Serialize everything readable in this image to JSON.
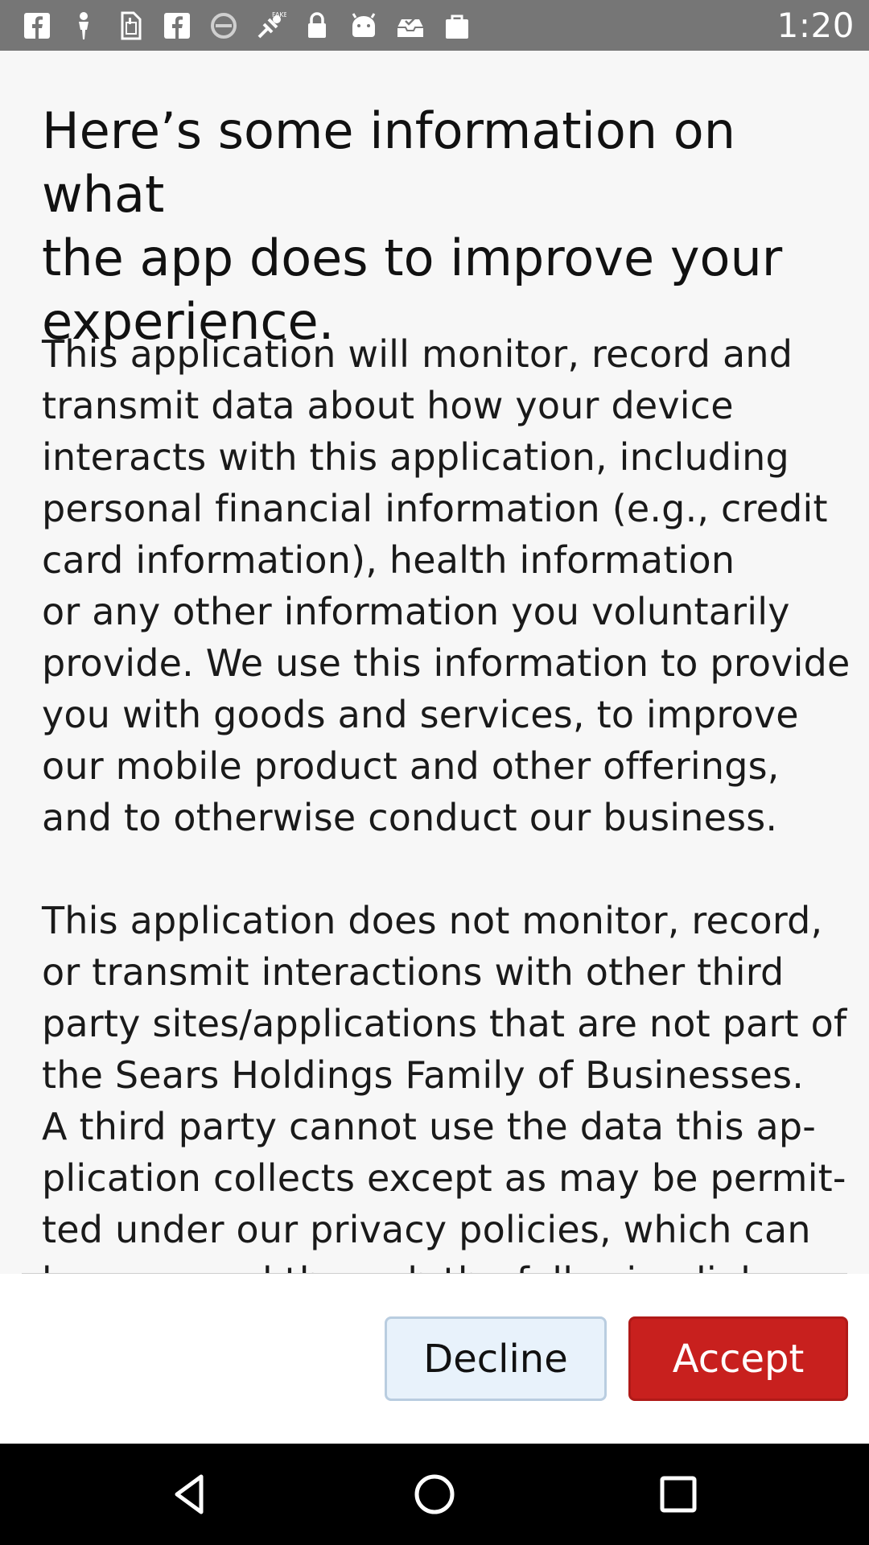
{
  "status_bar": {
    "time": "1:20",
    "icons": [
      "facebook-icon",
      "person-icon",
      "sim-icon",
      "facebook-icon",
      "blocked-icon",
      "fake-gps-icon",
      "lock-icon",
      "android-icon",
      "inbox-icon",
      "bag-icon"
    ],
    "background": "#767676"
  },
  "dialog": {
    "title": "Here’s some information on what\nthe app does to improve your\nexperience.",
    "body": "This application will monitor, record and\ntransmit data about how your device\ninteracts with this application, including\npersonal financial information (e.g., credit\ncard information), health information\nor any other information you voluntarily\nprovide. We use this information to provide\nyou with goods and services, to improve\nour mobile product and other offerings,\nand to otherwise conduct our business.\n\nThis application does not monitor, record,\nor transmit interactions with other third\nparty sites/applications that are not part of\nthe Sears Holdings Family of Businesses.\nA third party cannot use the data this ap-\nplication collects except as may be permit-\nted under our privacy policies, which can\nbe accessed through the following links:"
  },
  "buttons": {
    "decline_label": "Decline",
    "accept_label": "Accept",
    "accept_color": "#c8201e",
    "decline_color": "#e8f2fb"
  },
  "nav_bar": {
    "items": [
      "back-icon",
      "home-icon",
      "recents-icon"
    ]
  }
}
